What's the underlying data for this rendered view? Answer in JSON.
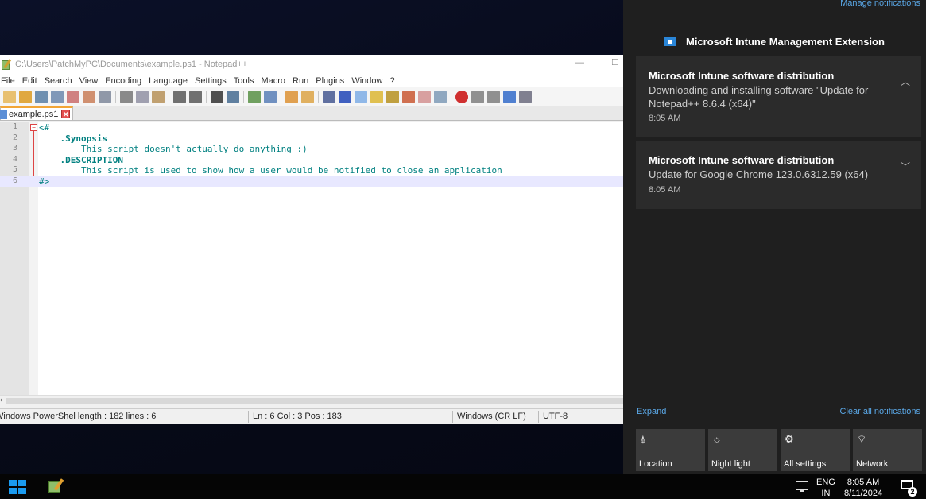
{
  "notepad": {
    "title": "C:\\Users\\PatchMyPC\\Documents\\example.ps1 - Notepad++",
    "menu": [
      "File",
      "Edit",
      "Search",
      "View",
      "Encoding",
      "Language",
      "Settings",
      "Tools",
      "Macro",
      "Run",
      "Plugins",
      "Window",
      "?"
    ],
    "tab_label": "example.ps1",
    "lines": [
      {
        "num": "1",
        "text": "<#"
      },
      {
        "num": "2",
        "text": "    .Synopsis"
      },
      {
        "num": "3",
        "text": "        This script doesn't actually do anything :)"
      },
      {
        "num": "4",
        "text": "    .DESCRIPTION"
      },
      {
        "num": "5",
        "text": "        This script is used to show how a user would be notified to close an application"
      },
      {
        "num": "6",
        "text": "#>"
      }
    ],
    "status": {
      "type_length": "Windows PowerShel length : 182    lines : 6",
      "position": "Ln : 6    Col : 3    Pos : 183",
      "eol": "Windows (CR LF)",
      "encoding": "UTF-8"
    }
  },
  "action_center": {
    "manage_link": "Manage notifications",
    "group_title": "Microsoft Intune Management Extension",
    "notifications": [
      {
        "title": "Microsoft Intune software distribution",
        "body": "Downloading and installing software \"Update for Notepad++ 8.6.4 (x64)\"",
        "time": "8:05 AM"
      },
      {
        "title": "Microsoft Intune software distribution",
        "body": "Update for Google Chrome 123.0.6312.59 (x64)",
        "time": "8:05 AM"
      }
    ],
    "expand_label": "Expand",
    "clear_all_label": "Clear all notifications",
    "quick_actions": [
      {
        "label": "Location",
        "icon": "location-icon"
      },
      {
        "label": "Night light",
        "icon": "night-light-icon"
      },
      {
        "label": "All settings",
        "icon": "gear-icon"
      },
      {
        "label": "Network",
        "icon": "network-icon"
      }
    ]
  },
  "taskbar": {
    "lang_top": "ENG",
    "lang_bottom": "IN",
    "time": "8:05 AM",
    "date": "8/11/2024",
    "notification_count": "2"
  }
}
